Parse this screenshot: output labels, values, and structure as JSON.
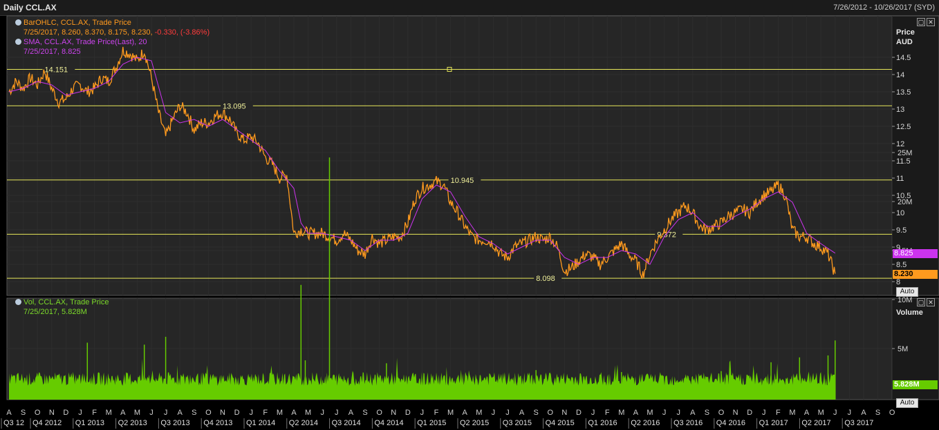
{
  "header": {
    "title": "Daily CCL.AX",
    "date_range": "7/26/2012 - 10/26/2017 (SYD)"
  },
  "legends": {
    "price_line1": "BarOHLC, CCL.AX, Trade Price",
    "price_line2_date": "7/25/2017, ",
    "price_line2_vals": "8.260, 8.370, 8.175, 8.230, ",
    "price_line2_change": "-0.330, (-3.86%)",
    "sma_line1": "SMA, CCL.AX, Trade Price(Last),  20",
    "sma_line2": "7/25/2017, 8.825",
    "vol_line1": "Vol, CCL.AX, Trade Price",
    "vol_line2": "7/25/2017, 5.828M"
  },
  "axes": {
    "price_title1": "Price",
    "price_title2": "AUD",
    "volume_title": "Volume",
    "auto_label": "Auto",
    "price_badge": "8.230",
    "sma_badge": "8.825",
    "volume_badge": "5.828M"
  },
  "colors": {
    "price": "#ff9a1e",
    "sma": "#cc33ee",
    "volume": "#66cc00",
    "hline": "#e8e85a",
    "change_neg": "#ff3b3b",
    "grid": "#2e2e2e"
  },
  "chart_data": {
    "type": "line",
    "price_ticks": [
      "8",
      "8.5",
      "9",
      "9.5",
      "10",
      "10.5",
      "11",
      "11.5",
      "12",
      "12.5",
      "13",
      "13.5",
      "14",
      "14.5"
    ],
    "price_ylim": [
      7.9,
      14.85
    ],
    "volume_ticks": [
      "5M",
      "10M",
      "15M",
      "20M",
      "25M"
    ],
    "volume_ylim": [
      0,
      30
    ],
    "x_months": [
      "A",
      "S",
      "O",
      "N",
      "D",
      "J",
      "F",
      "M",
      "A",
      "M",
      "J",
      "J",
      "A",
      "S",
      "O",
      "N",
      "D",
      "J",
      "F",
      "M",
      "A",
      "M",
      "J",
      "J",
      "A",
      "S",
      "O",
      "N",
      "D",
      "J",
      "F",
      "M",
      "A",
      "M",
      "J",
      "J",
      "A",
      "S",
      "O",
      "N",
      "D",
      "J",
      "F",
      "M",
      "A",
      "M",
      "J",
      "J",
      "A",
      "S",
      "O",
      "N",
      "D",
      "J",
      "F",
      "M",
      "A",
      "M",
      "J",
      "J",
      "A",
      "S",
      "O"
    ],
    "x_quarters": [
      "Q3 12",
      "Q4 2012",
      "Q1 2013",
      "Q2 2013",
      "Q3 2013",
      "Q4 2013",
      "Q1 2014",
      "Q2 2014",
      "Q3 2014",
      "Q4 2014",
      "Q1 2015",
      "Q2 2015",
      "Q3 2015",
      "Q4 2015",
      "Q1 2016",
      "Q2 2016",
      "Q3 2016",
      "Q4 2016",
      "Q1 2017",
      "Q2 2017",
      "Q3 2017"
    ],
    "hlines": [
      {
        "value": 14.151,
        "label": "14.151",
        "label_month": 2.5
      },
      {
        "value": 13.095,
        "label": "13.095",
        "label_month": 15
      },
      {
        "value": 10.945,
        "label": "10.945",
        "label_month": 31
      },
      {
        "value": 9.372,
        "label": "9.372",
        "label_month": 45.5
      },
      {
        "value": 8.098,
        "label": "8.098",
        "label_month": 37
      }
    ],
    "price_series": [
      [
        0,
        13.5
      ],
      [
        0.5,
        13.8
      ],
      [
        1,
        13.6
      ],
      [
        1.5,
        13.9
      ],
      [
        2,
        13.7
      ],
      [
        2.5,
        14.1
      ],
      [
        3,
        13.6
      ],
      [
        3.5,
        13.2
      ],
      [
        4,
        13.3
      ],
      [
        4.5,
        13.6
      ],
      [
        5,
        13.7
      ],
      [
        5.5,
        13.5
      ],
      [
        6,
        13.6
      ],
      [
        6.5,
        13.9
      ],
      [
        7,
        13.8
      ],
      [
        7.5,
        14.2
      ],
      [
        8,
        14.7
      ],
      [
        8.5,
        14.6
      ],
      [
        9,
        14.4
      ],
      [
        9.5,
        14.7
      ],
      [
        10,
        13.9
      ],
      [
        10.5,
        12.9
      ],
      [
        11,
        12.2
      ],
      [
        11.5,
        12.7
      ],
      [
        12,
        13.1
      ],
      [
        12.5,
        12.9
      ],
      [
        13,
        12.4
      ],
      [
        13.5,
        12.6
      ],
      [
        14,
        12.6
      ],
      [
        14.5,
        12.8
      ],
      [
        15,
        12.9
      ],
      [
        15.5,
        12.7
      ],
      [
        16,
        12.3
      ],
      [
        16.5,
        12.1
      ],
      [
        17,
        12.2
      ],
      [
        17.5,
        12.0
      ],
      [
        18,
        11.6
      ],
      [
        18.5,
        11.4
      ],
      [
        19,
        11.0
      ],
      [
        19.5,
        11.1
      ],
      [
        20,
        9.4
      ],
      [
        20.5,
        9.5
      ],
      [
        21,
        9.4
      ],
      [
        21.5,
        9.4
      ],
      [
        22,
        9.4
      ],
      [
        22.5,
        9.3
      ],
      [
        23,
        9.2
      ],
      [
        23.5,
        9.4
      ],
      [
        24,
        9.2
      ],
      [
        24.5,
        8.9
      ],
      [
        25,
        8.8
      ],
      [
        25.5,
        9.3
      ],
      [
        26,
        9.1
      ],
      [
        26.5,
        9.2
      ],
      [
        27,
        9.3
      ],
      [
        27.5,
        9.3
      ],
      [
        28,
        9.7
      ],
      [
        28.5,
        10.4
      ],
      [
        29,
        10.7
      ],
      [
        29.5,
        10.8
      ],
      [
        30,
        10.9
      ],
      [
        30.5,
        10.8
      ],
      [
        31,
        10.3
      ],
      [
        31.5,
        10.0
      ],
      [
        32,
        9.6
      ],
      [
        32.5,
        9.3
      ],
      [
        33,
        9.2
      ],
      [
        33.5,
        9.2
      ],
      [
        34,
        9.1
      ],
      [
        34.5,
        8.8
      ],
      [
        35,
        8.7
      ],
      [
        35.5,
        9.0
      ],
      [
        36,
        9.1
      ],
      [
        36.5,
        9.2
      ],
      [
        37,
        9.3
      ],
      [
        37.5,
        9.2
      ],
      [
        38,
        9.3
      ],
      [
        38.5,
        9.0
      ],
      [
        39,
        8.3
      ],
      [
        39.5,
        8.4
      ],
      [
        40,
        8.6
      ],
      [
        40.5,
        8.8
      ],
      [
        41,
        8.7
      ],
      [
        41.5,
        8.5
      ],
      [
        42,
        8.7
      ],
      [
        42.5,
        8.9
      ],
      [
        43,
        9.1
      ],
      [
        43.5,
        8.8
      ],
      [
        44,
        8.6
      ],
      [
        44.5,
        8.2
      ],
      [
        45,
        8.8
      ],
      [
        45.5,
        9.2
      ],
      [
        46,
        9.5
      ],
      [
        46.5,
        9.8
      ],
      [
        47,
        10.0
      ],
      [
        47.5,
        10.2
      ],
      [
        48,
        10.0
      ],
      [
        48.5,
        9.6
      ],
      [
        49,
        9.5
      ],
      [
        49.5,
        9.6
      ],
      [
        50,
        9.7
      ],
      [
        50.5,
        9.9
      ],
      [
        51,
        10.0
      ],
      [
        51.5,
        10.1
      ],
      [
        52,
        10.0
      ],
      [
        52.5,
        10.3
      ],
      [
        53,
        10.5
      ],
      [
        53.5,
        10.6
      ],
      [
        54,
        10.8
      ],
      [
        54.5,
        10.5
      ],
      [
        55,
        9.5
      ],
      [
        55.5,
        9.3
      ],
      [
        56,
        9.3
      ],
      [
        56.5,
        9.1
      ],
      [
        57,
        9.0
      ],
      [
        57.5,
        8.8
      ],
      [
        58,
        8.23
      ]
    ],
    "sma_series": [
      [
        0,
        13.5
      ],
      [
        1,
        13.6
      ],
      [
        2,
        13.8
      ],
      [
        3,
        13.7
      ],
      [
        4,
        13.4
      ],
      [
        5,
        13.5
      ],
      [
        6,
        13.6
      ],
      [
        7,
        13.8
      ],
      [
        8,
        14.3
      ],
      [
        9,
        14.5
      ],
      [
        10,
        14.4
      ],
      [
        11,
        12.9
      ],
      [
        12,
        12.6
      ],
      [
        13,
        12.7
      ],
      [
        14,
        12.5
      ],
      [
        15,
        12.7
      ],
      [
        16,
        12.4
      ],
      [
        17,
        12.1
      ],
      [
        18,
        11.8
      ],
      [
        19,
        11.2
      ],
      [
        20,
        10.7
      ],
      [
        20.5,
        9.7
      ],
      [
        21,
        9.4
      ],
      [
        22,
        9.4
      ],
      [
        23,
        9.3
      ],
      [
        24,
        9.2
      ],
      [
        25,
        8.9
      ],
      [
        26,
        9.2
      ],
      [
        27,
        9.2
      ],
      [
        28,
        9.4
      ],
      [
        29,
        10.4
      ],
      [
        30,
        10.8
      ],
      [
        31,
        10.6
      ],
      [
        32,
        9.9
      ],
      [
        33,
        9.3
      ],
      [
        34,
        9.1
      ],
      [
        35,
        8.8
      ],
      [
        36,
        9.0
      ],
      [
        37,
        9.2
      ],
      [
        38,
        9.2
      ],
      [
        39,
        8.7
      ],
      [
        40,
        8.5
      ],
      [
        41,
        8.7
      ],
      [
        42,
        8.7
      ],
      [
        43,
        8.9
      ],
      [
        44,
        8.8
      ],
      [
        45,
        8.5
      ],
      [
        46,
        9.3
      ],
      [
        47,
        9.8
      ],
      [
        48,
        10.0
      ],
      [
        49,
        9.6
      ],
      [
        50,
        9.6
      ],
      [
        51,
        9.9
      ],
      [
        52,
        10.1
      ],
      [
        53,
        10.4
      ],
      [
        54,
        10.6
      ],
      [
        55,
        10.3
      ],
      [
        56,
        9.4
      ],
      [
        57,
        9.1
      ],
      [
        58,
        8.825
      ]
    ],
    "volume_spikes": [
      [
        5.5,
        5.6
      ],
      [
        9.5,
        5.4
      ],
      [
        11,
        6.2
      ],
      [
        20.5,
        11.5
      ],
      [
        22.5,
        24.5
      ],
      [
        20.8,
        3.8
      ],
      [
        26.5,
        3.5
      ],
      [
        37,
        2.8
      ],
      [
        43,
        2.6
      ],
      [
        50,
        2.7
      ],
      [
        53.5,
        3.6
      ],
      [
        55.5,
        4.1
      ],
      [
        57.5,
        4.3
      ],
      [
        58,
        5.828
      ]
    ]
  }
}
